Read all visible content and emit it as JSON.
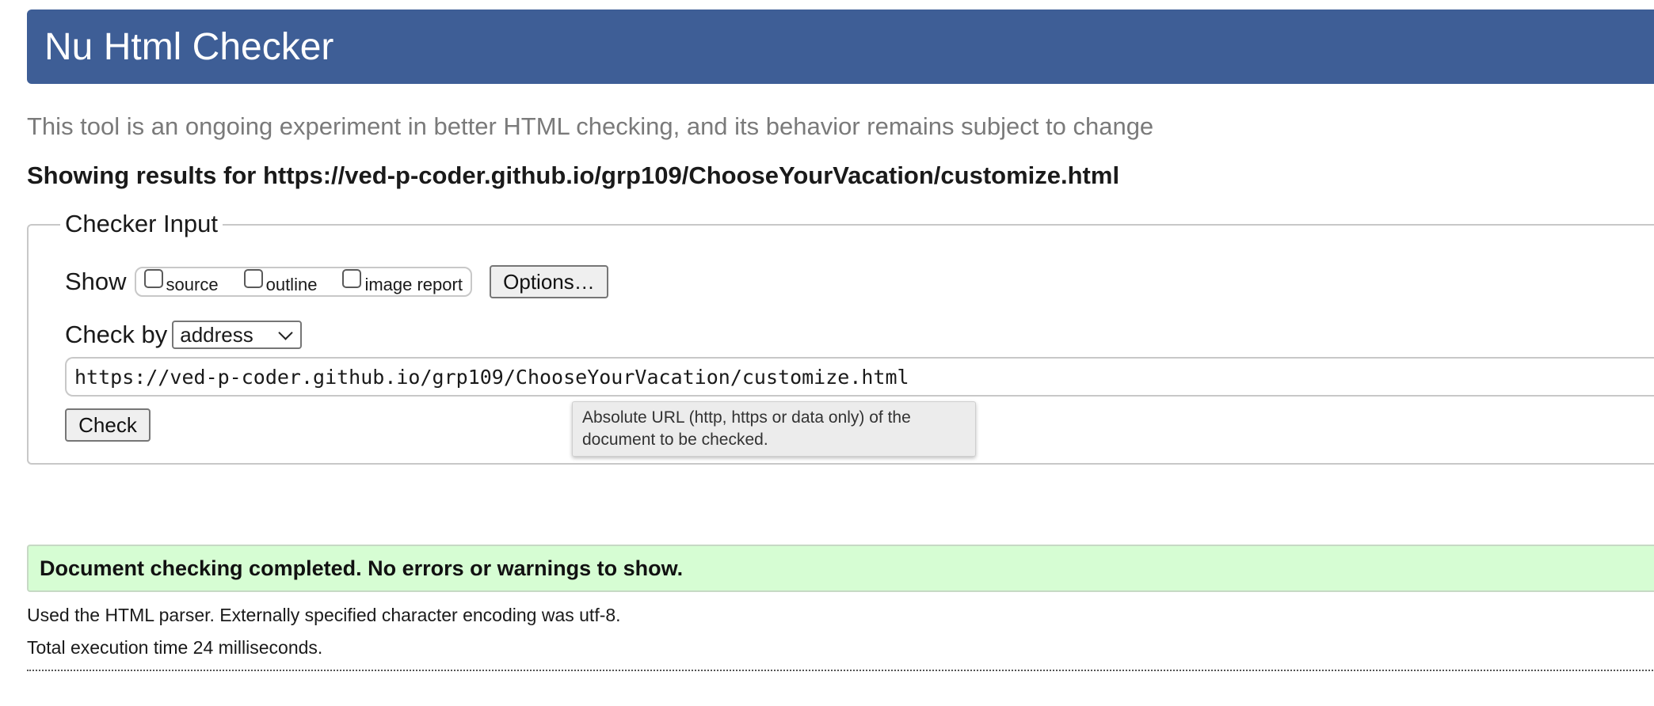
{
  "header": {
    "title": "Nu Html Checker",
    "accent_color": "#3e5e96"
  },
  "tagline": "This tool is an ongoing experiment in better HTML checking, and its behavior remains subject to change",
  "results_for": "Showing results for https://ved-p-coder.github.io/grp109/ChooseYourVacation/customize.html",
  "checker_input": {
    "legend": "Checker Input",
    "show": {
      "label": "Show",
      "options": [
        {
          "label": "source",
          "checked": false
        },
        {
          "label": "outline",
          "checked": false
        },
        {
          "label": "image report",
          "checked": false
        }
      ],
      "options_button": "Options…"
    },
    "check_by": {
      "label": "Check by",
      "selected": "address"
    },
    "url_input": {
      "value": "https://ved-p-coder.github.io/grp109/ChooseYourVacation/customize.html"
    },
    "check_button": "Check",
    "tooltip": "Absolute URL (http, https or data only) of the document to be checked."
  },
  "result": {
    "message": "Document checking completed. No errors or warnings to show.",
    "success_color": "#d6fdd3",
    "info": [
      "Used the HTML parser. Externally specified character encoding was utf-8.",
      "Total execution time 24 milliseconds."
    ]
  }
}
